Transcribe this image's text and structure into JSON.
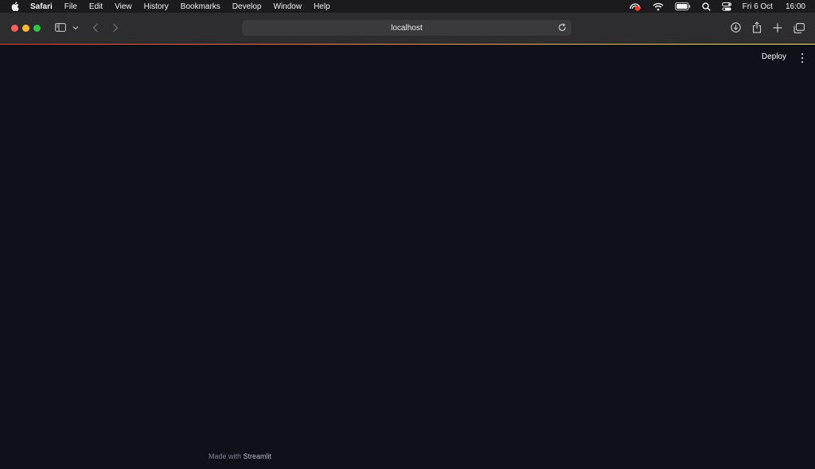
{
  "menubar": {
    "app_name": "Safari",
    "items": [
      "File",
      "Edit",
      "View",
      "History",
      "Bookmarks",
      "Develop",
      "Window",
      "Help"
    ],
    "date": "Fri 6 Oct",
    "time": "16:00"
  },
  "browser": {
    "url": "localhost"
  },
  "page": {
    "deploy_label": "Deploy",
    "footer_prefix": "Made with",
    "footer_brand": "Streamlit"
  },
  "colors": {
    "page_background": "#0e1117",
    "toolbar_background": "#2d2c2f",
    "accent_line_start": "#ff4b4b",
    "accent_line_end": "#fffd80"
  }
}
